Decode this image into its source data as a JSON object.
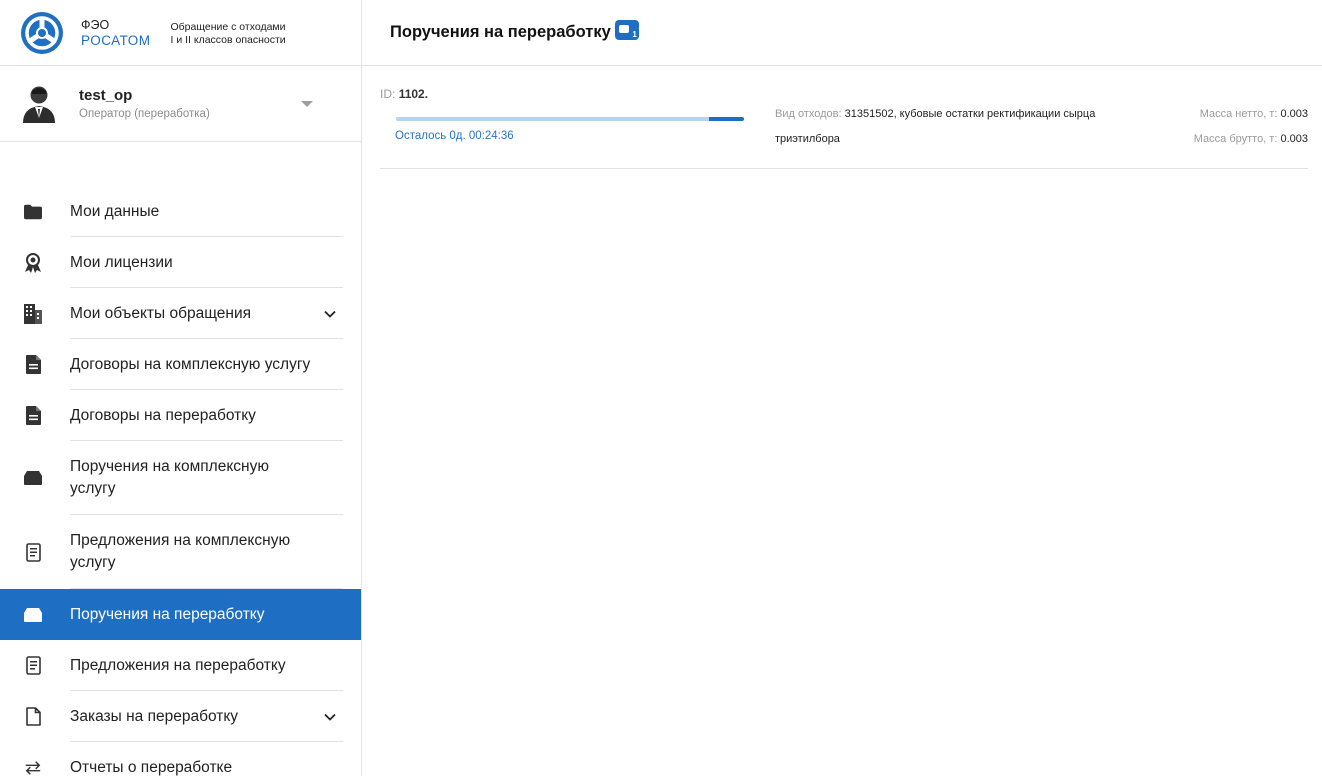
{
  "brand": {
    "abbr": "ФЭО",
    "name": "РОСАТОМ",
    "desc_line1": "Обращение с отходами",
    "desc_line2": "I и II классов опасности"
  },
  "user": {
    "name": "test_op",
    "role": "Оператор (переработка)"
  },
  "menu": {
    "items": [
      {
        "label": "Мои данные",
        "icon": "folder-icon"
      },
      {
        "label": "Мои лицензии",
        "icon": "award-icon"
      },
      {
        "label": "Мои объекты обращения",
        "icon": "building-icon",
        "expandable": true
      },
      {
        "label": "Договоры на комплексную услугу",
        "icon": "document-icon"
      },
      {
        "label": "Договоры на переработку",
        "icon": "document-icon"
      },
      {
        "label": "Поручения на комплексную услугу",
        "icon": "tray-icon"
      },
      {
        "label": "Предложения на комплексную услугу",
        "icon": "list-document-icon"
      },
      {
        "label": "Поручения на переработку",
        "icon": "tray-icon",
        "active": true
      },
      {
        "label": "Предложения на переработку",
        "icon": "list-document-icon"
      },
      {
        "label": "Заказы на переработку",
        "icon": "blank-document-icon",
        "expandable": true
      },
      {
        "label": "Отчеты о переработке",
        "icon": "swap-icon"
      }
    ]
  },
  "header": {
    "title": "Поручения на переработку",
    "badge_count": "1"
  },
  "order": {
    "id_label": "ID:",
    "id_value": "1102.",
    "progress_fraction": 0.1,
    "time_left": "Осталось 0д. 00:24:36",
    "waste_label": "Вид отходов:",
    "waste_value_line1": "31351502, кубовые остатки ректификации сырца",
    "waste_value_line2": "триэтилбора",
    "net_label": "Масса нетто, т:",
    "net_value": "0.003",
    "gross_label": "Масса брутто, т:",
    "gross_value": "0.003"
  },
  "colors": {
    "accent": "#1e6fc3",
    "progress_track": "#b8d3ee",
    "muted_text": "#9a9a9a"
  }
}
